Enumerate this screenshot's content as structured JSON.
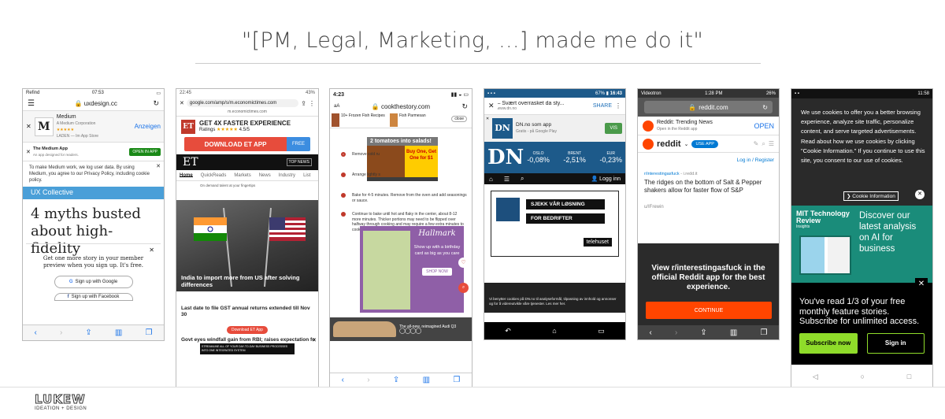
{
  "slide": {
    "title": "\"[PM, Legal, Marketing, ...] made me do it\"",
    "logo": {
      "wordmark": "LUKEW",
      "tagline": "IDEATION + DESIGN"
    }
  },
  "phones": {
    "uxdesign": {
      "status": {
        "carrier": "Refind",
        "time": "07:53"
      },
      "url": "uxdesign.cc",
      "app_name": "Medium",
      "app_corp": "A Medium Corporation",
      "app_store": "LADEN — Im App Store",
      "app_open": "Anzeigen",
      "medium_app": "The Medium App",
      "medium_app_sub": "An app designed for readers.",
      "open_in_app": "OPEN IN APP",
      "cookie_text": "To make Medium work, we log user data. By using Medium, you agree to our Privacy Policy, including cookie policy.",
      "collective": "UX Collective",
      "headline": "4 myths busted about high-fidelity",
      "signup_prompt": "Get one more story in your member preview when you sign up. It's free.",
      "google_btn": "Sign up with Google",
      "facebook_btn": "Sign up with Facebook"
    },
    "et": {
      "status": {
        "time": "22:45",
        "battery": "43%"
      },
      "url": "google.com/amp/s/m.economictimes.com",
      "sub_url": "m.economictimes.com",
      "promo_title": "GET 4X FASTER EXPERIENCE",
      "ratings": "Ratings",
      "rating_value": "4.5/5",
      "download": "DOWNLOAD ET APP",
      "free": "FREE",
      "logo": "ET",
      "top_news": "TOP NEWS",
      "nav": [
        "Home",
        "QuickReads",
        "Markets",
        "News",
        "Industry",
        "List"
      ],
      "ad_text": "On demand talent at your fingertips",
      "story1": "India to import more from US after solving differences",
      "story2": "Last date to file GST annual returns extended till Nov 30",
      "download_small": "Download ET App",
      "story3": "Govt eyes windfall gain from RBI; raises expectation fo",
      "ad_bottom": "STREAMLINE ALL OF YOUR DAY-TO-DAY BUSINESS PROCESSES INTO ONE INTEGRATED SYSTEM"
    },
    "cook": {
      "status": {
        "time": "4:23"
      },
      "url": "cookthestory.com",
      "ad_top_left": "10+ Frozen Fish Recipes",
      "ad_top_right": "Fish Parmesan",
      "ad_close": "close",
      "ad_title": "2 tomatoes into salads!",
      "ad_promo": "Buy One, Get One for $1",
      "steps": [
        "Remove cold ru",
        "Arrange lightly s",
        "Bake for 4-5 minutes. Remove from the oven and add seasonings or sauce.",
        "Continue to bake until hot and flaky in the center, about 8-12 more minutes. Thicker portions may need to be flipped over halfway through cooking and may require a few extra minutes to cook through."
      ],
      "hallmark": "Hallmark",
      "hallmark_text": "Show up with a birthday card as big as you care",
      "shop_now": "SHOP NOW",
      "audi_ad": "The all-new, reimagined Audi Q3"
    },
    "dn": {
      "status": {
        "battery": "67%",
        "time": "16:43"
      },
      "page_title": "– Svært overrasket da sty...",
      "page_url": "www.dn.no",
      "share": "SHARE",
      "app_title": "DN.no som app",
      "app_sub": "Gratis - på Google Play",
      "vis": "VIS",
      "logo": "DN",
      "tickers": [
        {
          "name": "OSLO",
          "value": "-0,08%"
        },
        {
          "name": "BRENT",
          "value": "-2,51%"
        },
        {
          "name": "EUR",
          "value": "-0,23%"
        }
      ],
      "login": "Logg inn",
      "ad_line1": "SJEKK VÅR LØSNING",
      "ad_line2": "FOR BEDRIFTER",
      "ad_brand": "telehuset",
      "cookie": "Vi benytter cookies på DN.no til analyseformål, tilpasning av innhold og annonser og for å videreutvikle våre tjenester. Les mer her."
    },
    "reddit": {
      "status": {
        "carrier": "Videotron",
        "time": "1:28 PM",
        "battery": "26%"
      },
      "url": "reddit.com",
      "app_title": "Reddit: Trending News",
      "app_sub": "Open in the Reddit app",
      "open": "OPEN",
      "logo": "reddit",
      "use_app": "USE APP",
      "login": "Log in / Register",
      "subreddit": "r/interestingasfuck",
      "domain": "i.redd.it",
      "post_title": "The ridges on the bottom of Salt & Pepper shakers allow for faster flow of S&P",
      "user": "u/IFrewin",
      "overlay": "View r/interestingasfuck in the official Reddit app for the best experience.",
      "continue": "CONTINUE"
    },
    "mit": {
      "status": {
        "time": "11:58"
      },
      "cookie": "We use cookies to offer you a better browsing experience, analyze site traffic, personalize content, and serve targeted advertisements. Read about how we use cookies by clicking \"Cookie Information.\" If you continue to use this site, you consent to our use of cookies.",
      "cookie_info": "Cookie Information",
      "brand": "MIT Technology Review",
      "brand_sub": "Insights",
      "ad_text": "Discover our latest analysis on AI for business",
      "paywall": "You've read 1/3 of your free monthly feature stories. Subscribe for unlimited access.",
      "subscribe": "Subscribe now",
      "signin": "Sign in"
    }
  }
}
